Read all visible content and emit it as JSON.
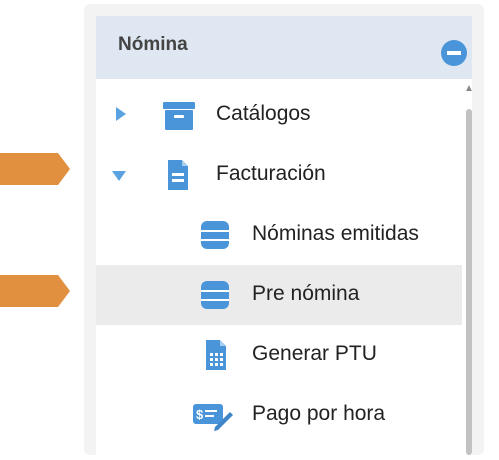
{
  "panel": {
    "title": "Nómina",
    "collapse_icon": "minus-circle-icon"
  },
  "tree": {
    "items": [
      {
        "label": "Catálogos",
        "icon": "archive-box-icon",
        "expanded": false
      },
      {
        "label": "Facturación",
        "icon": "document-icon",
        "expanded": true
      },
      {
        "label": "Nóminas emitidas",
        "icon": "database-icon"
      },
      {
        "label": "Pre nómina",
        "icon": "database-icon",
        "selected": true
      },
      {
        "label": "Generar PTU",
        "icon": "calculator-document-icon"
      },
      {
        "label": "Pago por hora",
        "icon": "payment-edit-icon"
      }
    ]
  },
  "colors": {
    "accent": "#4a95da",
    "arrow": "#e0903f",
    "header_bg": "#dfe8f2",
    "selected_bg": "#ebebeb"
  }
}
